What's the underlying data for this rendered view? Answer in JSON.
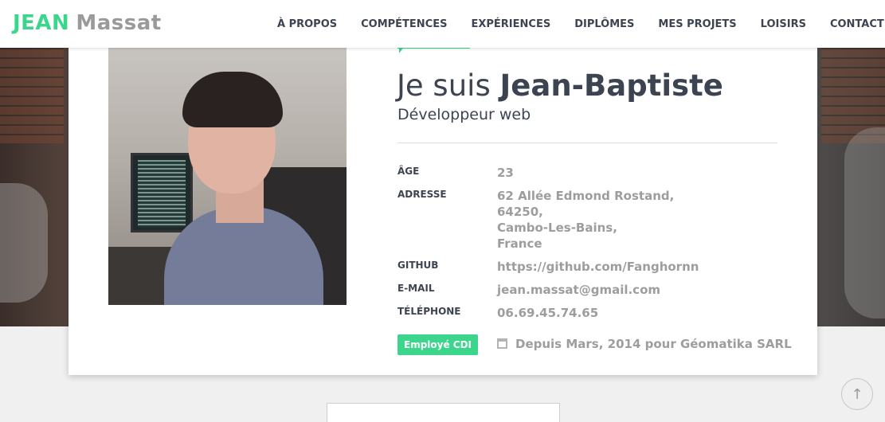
{
  "logo": {
    "first": "JEAN",
    "last": "Massat"
  },
  "nav": [
    "À PROPOS",
    "COMPÉTENCES",
    "EXPÉRIENCES",
    "DIPLÔMES",
    "MES PROJETS",
    "LOISIRS",
    "CONTACT"
  ],
  "profile": {
    "intro_prefix": "Je suis",
    "name": "Jean-Baptiste",
    "role": "Développeur web",
    "info": [
      {
        "label": "ÂGE",
        "value": "23"
      },
      {
        "label": "ADRESSE",
        "lines": [
          "62 Allée Edmond Rostand,",
          "64250,",
          "Cambo-Les-Bains,",
          "France"
        ]
      },
      {
        "label": "GITHUB",
        "value": "https://github.com/Fanghornn"
      },
      {
        "label": "E-MAIL",
        "value": "jean.massat@gmail.com"
      },
      {
        "label": "TÉLÉPHONE",
        "value": "06.69.45.74.65"
      }
    ],
    "badge": "Employé CDI",
    "since": "Depuis Mars, 2014 pour Géomatika SARL"
  },
  "colors": {
    "accent": "#3bd68c",
    "text": "#3d4451",
    "muted": "#9d9d9d"
  },
  "icons": {
    "calendar": "calendar-icon",
    "to_top": "arrow-up-icon"
  },
  "scroll_top_glyph": "↑"
}
